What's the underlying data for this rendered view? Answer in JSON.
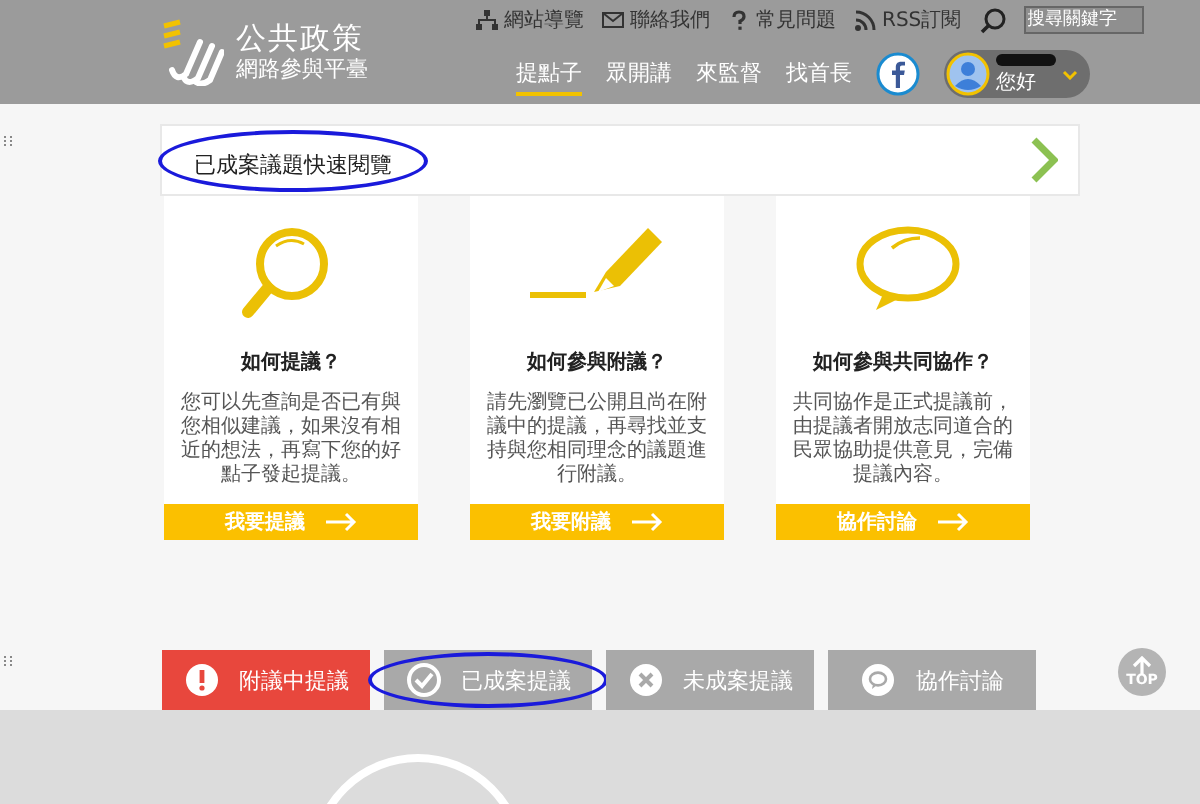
{
  "header": {
    "logo": {
      "title": "公共政策",
      "subtitle": "網路參與平臺"
    },
    "top_links": [
      {
        "kind": "sitemap",
        "label": "網站導覽"
      },
      {
        "kind": "mail",
        "label": "聯絡我們"
      },
      {
        "kind": "help",
        "label": "常見問題"
      },
      {
        "kind": "rss",
        "label": "RSS訂閱"
      }
    ],
    "search": {
      "placeholder": "搜尋關鍵字"
    },
    "nav": [
      {
        "label": "提點子",
        "selected": true
      },
      {
        "label": "眾開講",
        "selected": false
      },
      {
        "label": "來監督",
        "selected": false
      },
      {
        "label": "找首長",
        "selected": false
      }
    ],
    "user": {
      "greeting": "您好"
    }
  },
  "quick_view": {
    "label": "已成案議題快速閱覽",
    "circled": true
  },
  "cards": [
    {
      "kind": "search",
      "title": "如何提議？",
      "text": "您可以先查詢是否已有與您相似建議，如果沒有相近的想法，再寫下您的好點子發起提議。",
      "button": "我要提議"
    },
    {
      "kind": "pencil",
      "title": "如何參與附議？",
      "text": "請先瀏覽已公開且尚在附議中的提議，再尋找並支持與您相同理念的議題進行附議。",
      "button": "我要附議"
    },
    {
      "kind": "chat",
      "title": "如何參與共同協作？",
      "text": "共同協作是正式提議前，由提議者開放志同道合的民眾協助提供意見，完備提議內容。",
      "button": "協作討論"
    }
  ],
  "tabs": [
    {
      "kind": "alert",
      "label": "附議中提議",
      "selected": true,
      "circled": false
    },
    {
      "kind": "check",
      "label": "已成案提議",
      "selected": false,
      "circled": true
    },
    {
      "kind": "cross",
      "label": "未成案提議",
      "selected": false,
      "circled": false
    },
    {
      "kind": "chat",
      "label": "協作討論",
      "selected": false,
      "circled": false
    }
  ],
  "top_button": {
    "label": "TOP"
  }
}
